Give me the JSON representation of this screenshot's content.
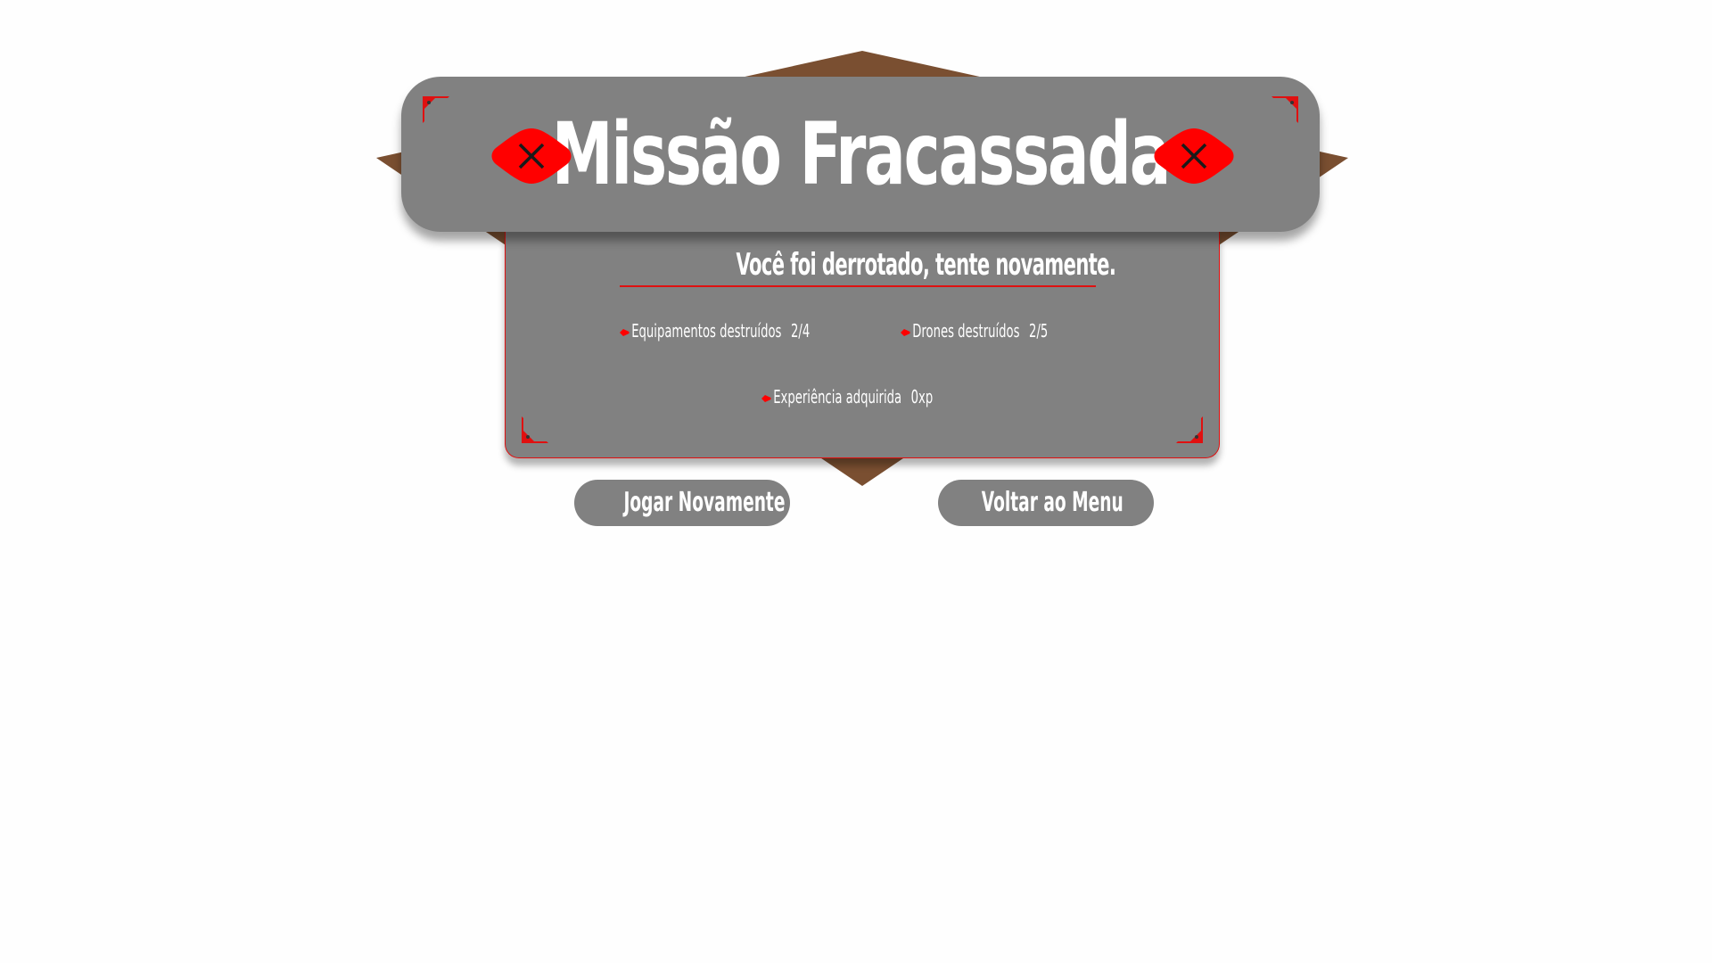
{
  "title": "Missão Fracassada",
  "subtitle": "Você foi derrotado, tente novamente.",
  "stats": [
    {
      "label": "Equipamentos destruídos",
      "value": "2/4"
    },
    {
      "label": "Drones destruídos",
      "value": "2/5"
    },
    {
      "label": "Experiência adquirida",
      "value": "0xp"
    }
  ],
  "buttons": {
    "play_again": "Jogar Novamente",
    "back_to_menu": "Voltar ao Menu"
  },
  "colors": {
    "panel": "#818181",
    "accent_red": "#ff0000",
    "frame_brown": "#7a4f31",
    "text": "#ffffff"
  },
  "icons": {
    "badge": "close-x-icon",
    "corner": "corner-ornament-icon",
    "bullet": "arrow-bullet-icon"
  }
}
